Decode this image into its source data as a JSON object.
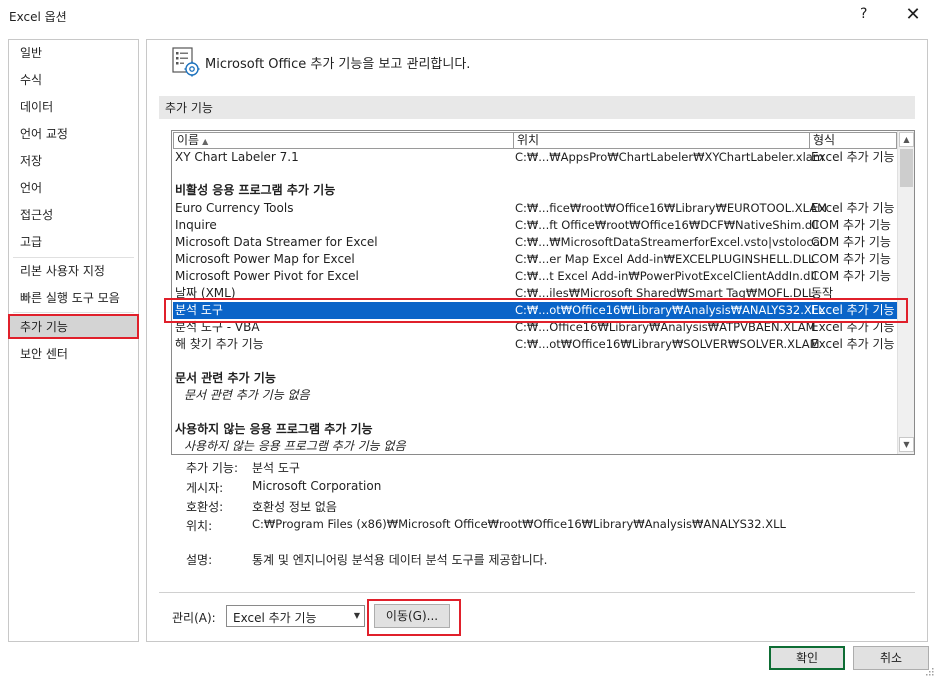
{
  "window": {
    "title": "Excel 옵션",
    "help_label": "?",
    "close_label": "✕"
  },
  "nav": {
    "items": [
      {
        "label": "일반"
      },
      {
        "label": "수식"
      },
      {
        "label": "데이터"
      },
      {
        "label": "언어 교정"
      },
      {
        "label": "저장"
      },
      {
        "label": "언어"
      },
      {
        "label": "접근성"
      },
      {
        "label": "고급"
      },
      {
        "label": "리본 사용자 지정"
      },
      {
        "label": "빠른 실행 도구 모음"
      },
      {
        "label": "추가 기능"
      },
      {
        "label": "보안 센터"
      }
    ],
    "selected_index": 10
  },
  "header": {
    "icon": "addins-gear-icon",
    "text": "Microsoft Office 추가 기능을 보고 관리합니다."
  },
  "section": {
    "title": "추가 기능"
  },
  "list": {
    "columns": [
      {
        "label": "이름"
      },
      {
        "label": "위치"
      },
      {
        "label": "형식"
      }
    ],
    "rows": [
      {
        "name": "XY Chart Labeler 7.1",
        "location": "C:₩...₩AppsPro₩ChartLabeler₩XYChartLabeler.xlam",
        "type": "Excel 추가 기능"
      },
      {
        "name": "Euro Currency Tools",
        "location": "C:₩...fice₩root₩Office16₩Library₩EUROTOOL.XLAM",
        "type": "Excel 추가 기능"
      },
      {
        "name": "Inquire",
        "location": "C:₩...ft Office₩root₩Office16₩DCF₩NativeShim.dll",
        "type": "COM 추가 기능"
      },
      {
        "name": "Microsoft Data Streamer for Excel",
        "location": "C:₩...₩MicrosoftDataStreamerforExcel.vsto|vstolocal",
        "type": "COM 추가 기능"
      },
      {
        "name": "Microsoft Power Map for Excel",
        "location": "C:₩...er Map Excel Add-in₩EXCELPLUGINSHELL.DLL",
        "type": "COM 추가 기능"
      },
      {
        "name": "Microsoft Power Pivot for Excel",
        "location": "C:₩...t Excel Add-in₩PowerPivotExcelClientAddIn.dll",
        "type": "COM 추가 기능"
      },
      {
        "name": "날짜 (XML)",
        "location": "C:₩...iles₩Microsoft Shared₩Smart Tag₩MOFL.DLL",
        "type": "동작"
      },
      {
        "name": "분석 도구",
        "location": "C:₩...ot₩Office16₩Library₩Analysis₩ANALYS32.XLL",
        "type": "Excel 추가 기능"
      },
      {
        "name": "분석 도구 - VBA",
        "location": "C:₩...Office16₩Library₩Analysis₩ATPVBAEN.XLAM",
        "type": "Excel 추가 기능"
      },
      {
        "name": "해 찾기 추가 기능",
        "location": "C:₩...ot₩Office16₩Library₩SOLVER₩SOLVER.XLAM",
        "type": "Excel 추가 기능"
      }
    ],
    "groups": {
      "inactive_title": "비활성 응용 프로그램 추가 기능",
      "document_title": "문서 관련 추가 기능",
      "document_empty": "문서 관련 추가 기능 없음",
      "disabled_title": "사용하지 않는 응용 프로그램 추가 기능",
      "disabled_empty": "사용하지 않는 응용 프로그램 추가 기능 없음"
    }
  },
  "details": {
    "addin_label": "추가 기능:",
    "addin_value": "분석 도구",
    "publisher_label": "게시자:",
    "publisher_value": "Microsoft Corporation",
    "compat_label": "호환성:",
    "compat_value": "호환성 정보 없음",
    "location_label": "위치:",
    "location_value": "C:₩Program Files (x86)₩Microsoft Office₩root₩Office16₩Library₩Analysis₩ANALYS32.XLL",
    "desc_label": "설명:",
    "desc_value": "통계 및 엔지니어링 분석용 데이터 분석 도구를 제공합니다."
  },
  "manage": {
    "label": "관리(A):",
    "value": "Excel 추가 기능",
    "go_label": "이동(G)..."
  },
  "footer": {
    "ok_label": "확인",
    "cancel_label": "취소"
  },
  "colors": {
    "selection": "#0a64c8",
    "highlight_outline": "#e0202b",
    "ok_border": "#0e6d34"
  }
}
